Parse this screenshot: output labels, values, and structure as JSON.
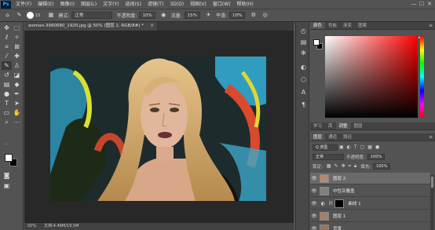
{
  "app": {
    "logo": "Ps"
  },
  "menu": [
    "文件(F)",
    "编辑(E)",
    "图像(I)",
    "图层(L)",
    "文字(Y)",
    "选择(S)",
    "滤镜(T)",
    "3D(D)",
    "视图(V)",
    "窗口(W)",
    "帮助(H)"
  ],
  "window_controls": {
    "minimize": "—",
    "maximize": "☐",
    "close": "✕"
  },
  "options_bar": {
    "brush_size": "15",
    "mode_label": "模式:",
    "mode_value": "正常",
    "opacity_label": "不透明度:",
    "opacity_value": "10%",
    "flow_label": "流量:",
    "flow_value": "15%",
    "smoothing_label": "平滑:",
    "smoothing_value": "10%"
  },
  "document": {
    "tab_title": "woman-3990680_1920.jpg @ 50% (图层 2, RGB/8#) *",
    "close": "✕"
  },
  "status_bar": {
    "zoom": "50%",
    "doc_info": "文档:4.48M/19.5M"
  },
  "color_panel": {
    "tabs": [
      "颜色",
      "色板",
      "渐变",
      "图案"
    ],
    "active_tab": 0
  },
  "library_panel": {
    "tabs": [
      "学习",
      "库",
      "调整",
      "图层"
    ]
  },
  "layers_panel": {
    "tabs": [
      "图层",
      "通道",
      "路径"
    ],
    "filter_kind": "Q 类型",
    "blend_mode": "正常",
    "opacity_label": "不透明度:",
    "opacity_value": "100%",
    "lock_label": "锁定:",
    "fill_label": "填充:",
    "fill_value": "100%",
    "layers": [
      {
        "name": "图层 2",
        "type": "pixel",
        "selected": true
      },
      {
        "name": "中性灰覆盖",
        "type": "gray",
        "selected": false
      },
      {
        "name": "曲线 1",
        "type": "adjustment",
        "selected": false
      },
      {
        "name": "图层 1",
        "type": "pixel",
        "selected": false
      },
      {
        "name": "背景",
        "type": "pixel",
        "selected": false
      }
    ]
  },
  "colors": {
    "ui_bg": "#535353",
    "canvas_bg": "#282828",
    "accent_logo": "#31a8ff",
    "foreground": "#ffffff",
    "background": "#000000"
  }
}
